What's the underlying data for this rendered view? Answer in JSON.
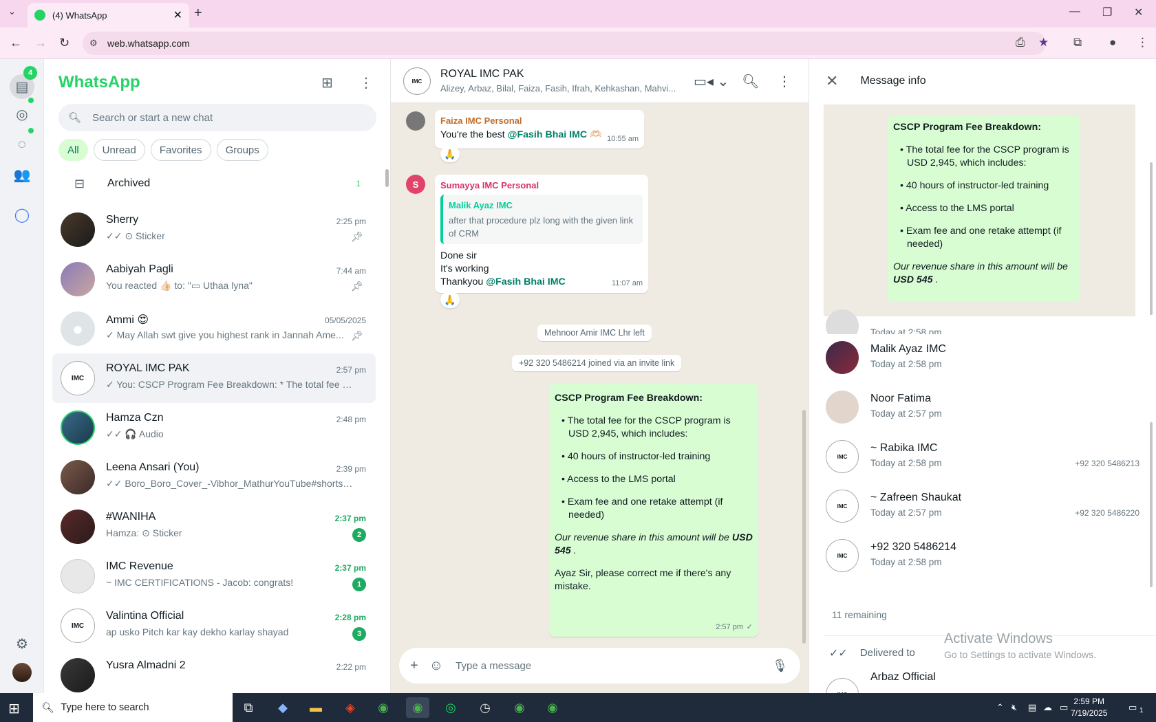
{
  "browser": {
    "tab_title": "(4) WhatsApp",
    "url": "web.whatsapp.com"
  },
  "rail": {
    "chats_badge": "4"
  },
  "sidebar": {
    "brand": "WhatsApp",
    "search_placeholder": "Search or start a new chat",
    "filters": [
      "All",
      "Unread",
      "Favorites",
      "Groups"
    ],
    "archived_label": "Archived",
    "archived_count": "1",
    "chats": [
      {
        "name": "Sherry",
        "time": "2:25 pm",
        "preview": "✓✓ ⊙ Sticker",
        "pinned": true
      },
      {
        "name": "Aabiyah Pagli",
        "time": "7:44 am",
        "preview": "You reacted 👍🏻 to: \"▭ Uthaa lyna\"",
        "pinned": true
      },
      {
        "name": "Ammi 😍",
        "time": "05/05/2025",
        "preview": "✓ May Allah swt give you highest rank in Jannah  Ame...",
        "pinned": true
      },
      {
        "name": "ROYAL IMC PAK",
        "time": "2:57 pm",
        "preview": "✓ You: CSCP Program Fee Breakdown: * The total fee for t..."
      },
      {
        "name": "Hamza Czn",
        "time": "2:48 pm",
        "preview": "✓✓ 🎧 Audio"
      },
      {
        "name": "Leena Ansari (You)",
        "time": "2:39 pm",
        "preview": "✓✓ Boro_Boro_Cover_-Vibhor_MathurYouTube#shorts_#Co..."
      },
      {
        "name": "#WANIHA",
        "time": "2:37 pm",
        "preview": "Hamza: ⊙ Sticker",
        "unread": "2"
      },
      {
        "name": "IMC Revenue",
        "time": "2:37 pm",
        "preview": "~ IMC CERTIFICATIONS - Jacob: congrats!",
        "unread": "1"
      },
      {
        "name": "Valintina Official",
        "time": "2:28 pm",
        "preview": "ap usko Pitch kar kay dekho karlay shayad",
        "unread": "3"
      },
      {
        "name": "Yusra Almadni 2",
        "time": "2:22 pm",
        "preview": ""
      }
    ]
  },
  "conversation": {
    "title": "ROYAL IMC PAK",
    "members": "Alizey, Arbaz, Bilal, Faiza, Fasih, Ifrah, Kehkashan, Mahvi...",
    "msg1": {
      "sender": "Faiza IMC Personal",
      "text": "You're the best ",
      "mention": "@Fasih Bhai IMC",
      "emoji": "🫶🏻",
      "time": "10:55 am",
      "reaction": "🙏"
    },
    "msg2": {
      "avatar_letter": "S",
      "sender": "Sumayya IMC Personal",
      "quote_name": "Malik Ayaz IMC",
      "quote_text": "after that procedure plz long with the given link of CRM",
      "line1": "Done sir",
      "line2": "It's working",
      "line3": "Thankyou ",
      "mention": "@Fasih Bhai IMC",
      "time": "11:07 am",
      "reaction": "🙏"
    },
    "sys1": "Mehnoor Amir IMC Lhr left",
    "sys2": "+92 320 5486214 joined via an invite link",
    "out": {
      "heading": "CSCP Program Fee Breakdown:",
      "b1": "• The total fee for the CSCP program is USD 2,945, which includes:",
      "b2": "• 40 hours of instructor-led training",
      "b3": "• Access to the LMS portal",
      "b4": "• Exam fee and one retake attempt (if needed)",
      "revenue_pre": "Our revenue share in this amount will be ",
      "revenue_amt": "USD 545",
      "revenue_post": " .",
      "closing": "Ayaz Sir, please correct me if there's any mistake.",
      "time": "2:57 pm"
    },
    "composer_placeholder": "Type a message"
  },
  "info": {
    "title": "Message info",
    "people": [
      {
        "name": "",
        "time": "Today at 2:58 pm",
        "phone": ""
      },
      {
        "name": "Malik Ayaz IMC",
        "time": "Today at 2:58 pm",
        "phone": ""
      },
      {
        "name": "Noor Fatima",
        "time": "Today at 2:57 pm",
        "phone": ""
      },
      {
        "name": "~ Rabika IMC",
        "time": "Today at 2:58 pm",
        "phone": "+92 320 5486213"
      },
      {
        "name": "~ Zafreen Shaukat",
        "time": "Today at 2:57 pm",
        "phone": "+92 320 5486220"
      },
      {
        "name": "+92 320 5486214",
        "time": "Today at 2:58 pm",
        "phone": ""
      }
    ],
    "remaining": "11 remaining",
    "delivered_label": "Delivered to",
    "next_person": "Arbaz Official",
    "activate_title": "Activate Windows",
    "activate_sub": "Go to Settings to activate Windows."
  },
  "taskbar": {
    "search_placeholder": "Type here to search",
    "time": "2:59 PM",
    "date": "7/19/2025",
    "notif_count": "1"
  },
  "colors": {
    "brand_green": "#25d366",
    "out_bubble": "#d9fdd3",
    "chat_bg": "#efeae2"
  }
}
